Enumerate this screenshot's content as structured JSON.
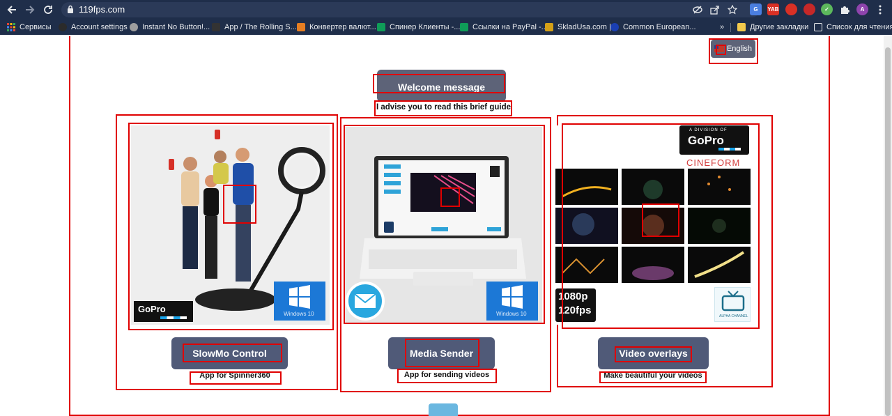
{
  "browser": {
    "url": "119fps.com",
    "bookmarks": [
      {
        "label": "Сервисы",
        "color": "#e0e0e0"
      },
      {
        "label": "Account settings",
        "color": "#2b2b2b"
      },
      {
        "label": "Instant No Button!...",
        "color": "#9e9e9e"
      },
      {
        "label": "App / The Rolling S...",
        "color": "#333333"
      },
      {
        "label": "Конвертер валют...",
        "color": "#e67e22"
      },
      {
        "label": "Спинер Клиенты -...",
        "color": "#0f9d58"
      },
      {
        "label": "Ссылки на PayPal -...",
        "color": "#0f9d58"
      },
      {
        "label": "SkladUsa.com |",
        "color": "#d4a017"
      },
      {
        "label": "Common European...",
        "color": "#1a3fb3"
      }
    ],
    "overflow_label": "»",
    "other_bookmarks": "Другие закладки",
    "reading_list": "Список для чтения",
    "extensions": [
      {
        "label": "G",
        "color": "#4a7ee0"
      },
      {
        "label": "YAB",
        "color": "#d93025"
      },
      {
        "label": "",
        "color": "#d93025"
      },
      {
        "label": "",
        "color": "#c62828"
      },
      {
        "label": "",
        "color": "#5cb85c"
      },
      {
        "label": "",
        "color": "#1f2e4a"
      },
      {
        "label": "A",
        "color": "#8e44ad"
      }
    ]
  },
  "page": {
    "language_button": "English",
    "welcome_button": "Welcome message",
    "guide_text": "I advise you to read this brief guide",
    "cards": [
      {
        "button": "SlowMo Control",
        "subtitle": "App for Spinner360",
        "badge": "GoPro",
        "os_label": "Windows 10"
      },
      {
        "button": "Media Sender",
        "subtitle": "App for sending videos",
        "os_label": "Windows 10"
      },
      {
        "button": "Video overlays",
        "subtitle": "Make beautiful your videos",
        "brand_top": "A DIVISION OF",
        "brand": "GoPro",
        "brand_sub": "CINEFORM",
        "badge_fps_1": "1080p",
        "badge_fps_2": "120fps",
        "tv_label": "ALPHA CHANNEL"
      }
    ]
  },
  "colors": {
    "button_bg": "#505a78",
    "annotation_red": "#e00000",
    "chrome_bg": "#1f2e4a"
  }
}
